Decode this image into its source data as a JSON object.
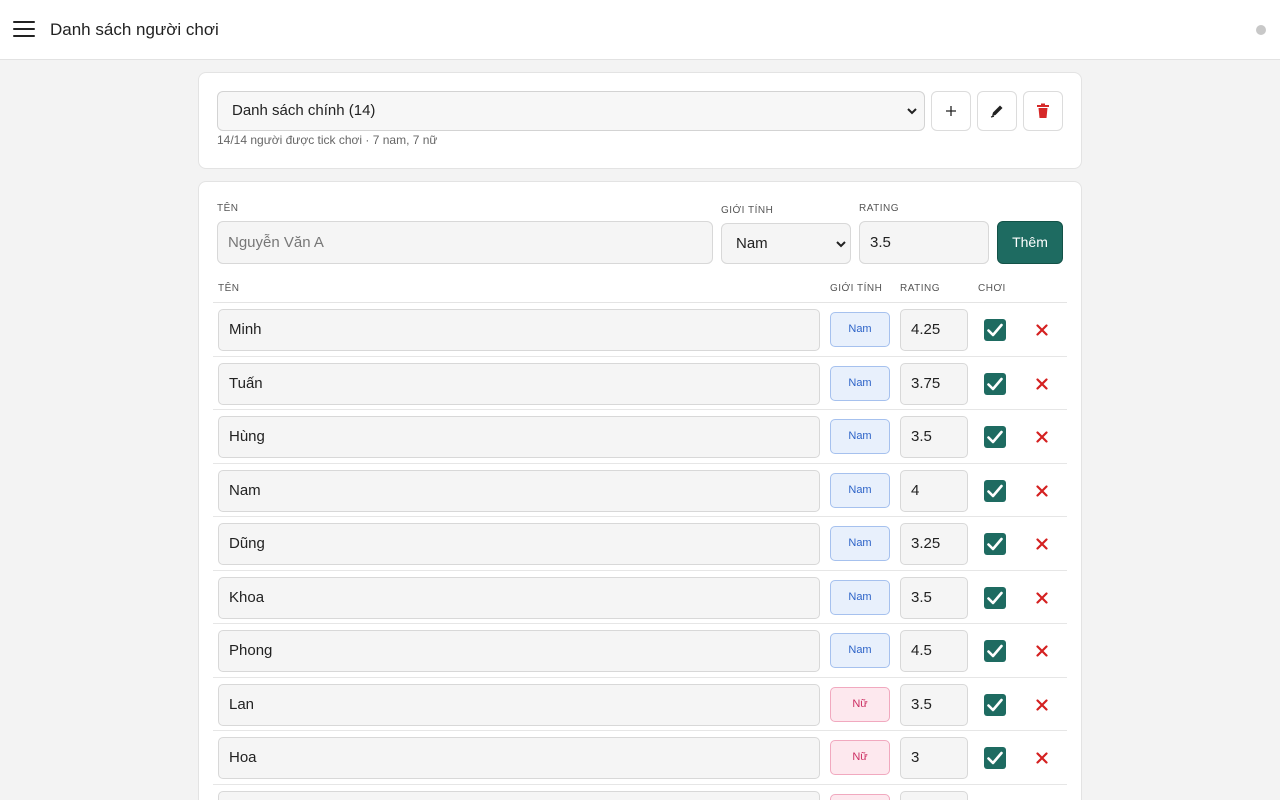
{
  "header": {
    "title": "Danh sách người chơi",
    "menu_icon": "hamburger-menu-icon",
    "status_icon": "status-dot-icon"
  },
  "list_card": {
    "selected_list": "Danh sách chính (14)",
    "summary": "14/14 người được tick chơi · 7 nam, 7 nữ",
    "add_icon": "plus-icon",
    "edit_icon": "pencil-icon",
    "delete_icon": "trash-icon"
  },
  "form": {
    "name_label": "TÊN",
    "name_placeholder": "Nguyễn Văn A",
    "gender_label": "GIỚI TÍNH",
    "gender_value": "Nam",
    "rating_label": "RATING",
    "rating_value": "3.5",
    "add_label": "Thêm"
  },
  "table": {
    "headers": [
      "TÊN",
      "GIỚI TÍNH",
      "RATING",
      "CHƠI"
    ],
    "rows": [
      {
        "name": "Minh",
        "gender": "Nam",
        "gender_type": "male",
        "rating": "4.25",
        "play": true
      },
      {
        "name": "Tuấn",
        "gender": "Nam",
        "gender_type": "male",
        "rating": "3.75",
        "play": true
      },
      {
        "name": "Hùng",
        "gender": "Nam",
        "gender_type": "male",
        "rating": "3.5",
        "play": true
      },
      {
        "name": "Nam",
        "gender": "Nam",
        "gender_type": "male",
        "rating": "4",
        "play": true
      },
      {
        "name": "Dũng",
        "gender": "Nam",
        "gender_type": "male",
        "rating": "3.25",
        "play": true
      },
      {
        "name": "Khoa",
        "gender": "Nam",
        "gender_type": "male",
        "rating": "3.5",
        "play": true
      },
      {
        "name": "Phong",
        "gender": "Nam",
        "gender_type": "male",
        "rating": "4.5",
        "play": true
      },
      {
        "name": "Lan",
        "gender": "Nữ",
        "gender_type": "female",
        "rating": "3.5",
        "play": true
      },
      {
        "name": "Hoa",
        "gender": "Nữ",
        "gender_type": "female",
        "rating": "3",
        "play": true
      },
      {
        "name": "",
        "gender": "Nữ",
        "gender_type": "female",
        "rating": "",
        "play": true
      }
    ]
  },
  "colors": {
    "accent": "#1e6b61",
    "male_badge": "#e8f0fc",
    "female_badge": "#fde8ee",
    "delete": "#d42020",
    "trash": "#d62828"
  }
}
